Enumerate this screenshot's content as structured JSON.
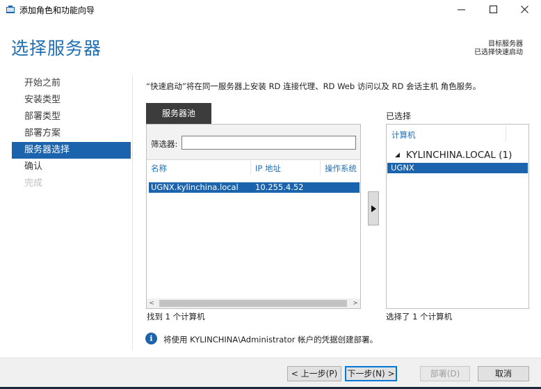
{
  "window": {
    "title": "添加角色和功能向导",
    "controls": [
      "minimize-icon",
      "maximize-icon",
      "close-icon"
    ]
  },
  "header": {
    "title": "选择服务器",
    "target_label": "目标服务器",
    "target_value": "已选择快速启动"
  },
  "nav": {
    "items": [
      {
        "label": "开始之前",
        "state": "normal"
      },
      {
        "label": "安装类型",
        "state": "normal"
      },
      {
        "label": "部署类型",
        "state": "normal"
      },
      {
        "label": "部署方案",
        "state": "normal"
      },
      {
        "label": "服务器选择",
        "state": "active"
      },
      {
        "label": "确认",
        "state": "normal"
      },
      {
        "label": "完成",
        "state": "disabled"
      }
    ]
  },
  "main": {
    "description": "“快速启动”将在同一服务器上安装 RD 连接代理、RD Web 访问以及 RD 会话主机 角色服务。",
    "pool": {
      "tab_label": "服务器池",
      "filter_label": "筛选器:",
      "filter_value": "",
      "columns": [
        "名称",
        "IP 地址",
        "操作系统"
      ],
      "rows": [
        {
          "name": "UGNX.kylinchina.local",
          "ip": "10.255.4.52",
          "os": ""
        }
      ],
      "count_text": "找到 1 个计算机"
    },
    "add_button_icon": "play-right-icon",
    "selected": {
      "label": "已选择",
      "column": "计算机",
      "group": "KYLINCHINA.LOCAL (1)",
      "items": [
        "UGNX"
      ],
      "count_text": "选择了 1 个计算机"
    },
    "info": {
      "icon": "info-icon",
      "text": "将使用 KYLINCHINA\\Administrator 帐户的凭据创建部署。"
    }
  },
  "footer": {
    "prev": "< 上一步(P)",
    "next": "下一步(N) >",
    "deploy": "部署(D)",
    "cancel": "取消"
  },
  "colors": {
    "accent": "#1b64ad",
    "title_blue": "#1f6fb4",
    "pool_tab": "#3c3c3c"
  }
}
